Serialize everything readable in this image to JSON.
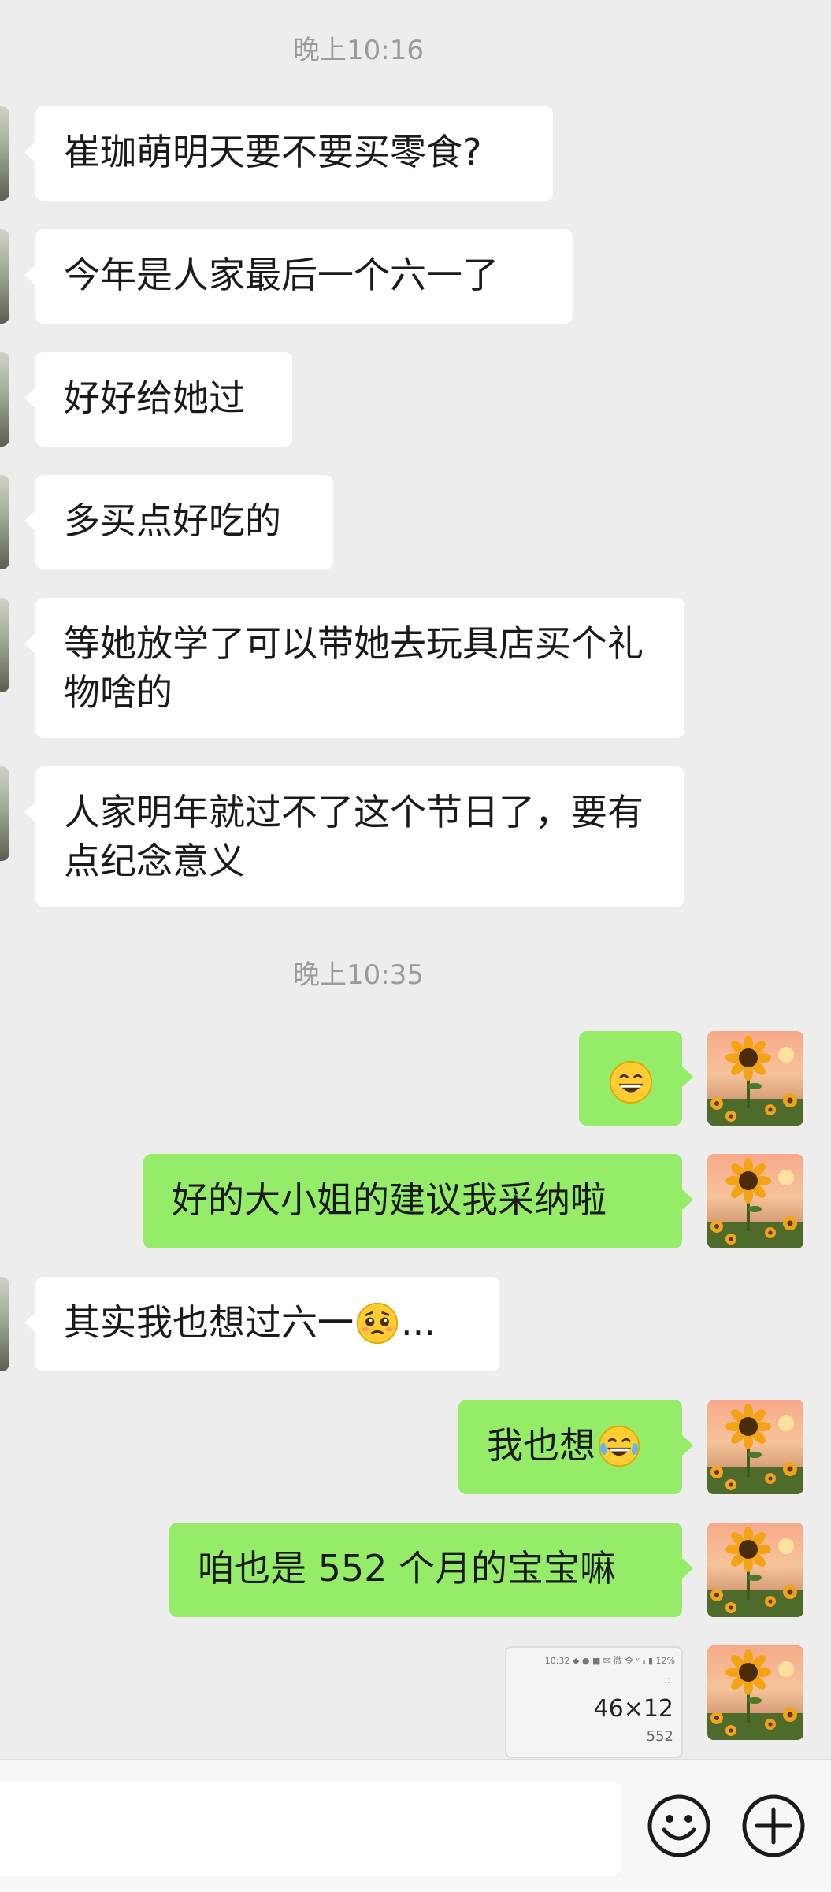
{
  "timestamps": {
    "first": "晚上10:16",
    "second": "晚上10:35"
  },
  "messages": [
    {
      "side": "left",
      "text": "崔珈萌明天要不要买零食?"
    },
    {
      "side": "left",
      "text": "今年是人家最后一个六一了"
    },
    {
      "side": "left",
      "text": "好好给她过"
    },
    {
      "side": "left",
      "text": "多买点好吃的"
    },
    {
      "side": "left",
      "text": "等她放学了可以带她去玩具店买个礼物啥的"
    },
    {
      "side": "left",
      "text": "人家明年就过不了这个节日了，要有点纪念意义"
    },
    {
      "side": "right",
      "emoji": "grinning-face-emoji"
    },
    {
      "side": "right",
      "text": "好的大小姐的建议我采纳啦"
    },
    {
      "side": "left",
      "text": "其实我也想过六一",
      "emoji": "pleading-face-emoji",
      "suffix": "..."
    },
    {
      "side": "right",
      "text": "我也想",
      "emoji": "tears-of-joy-emoji"
    },
    {
      "side": "right",
      "text": "咱也是 552 个月的宝宝嘛"
    },
    {
      "side": "right",
      "image": "calculator-screenshot"
    }
  ],
  "calculator": {
    "status": "10:32 ◆ ● ■ ✉  微 令 ᵛ ᵢₗ ▮ 12%",
    "dots": "::",
    "expression": "46×12",
    "result": "552"
  },
  "icons": {
    "emoji_button": "smiley-face-icon",
    "more_button": "plus-circle-icon"
  },
  "colors": {
    "background": "#ededed",
    "own_bubble": "#95ec69",
    "other_bubble": "#ffffff",
    "timestamp": "#9b9b9b"
  }
}
